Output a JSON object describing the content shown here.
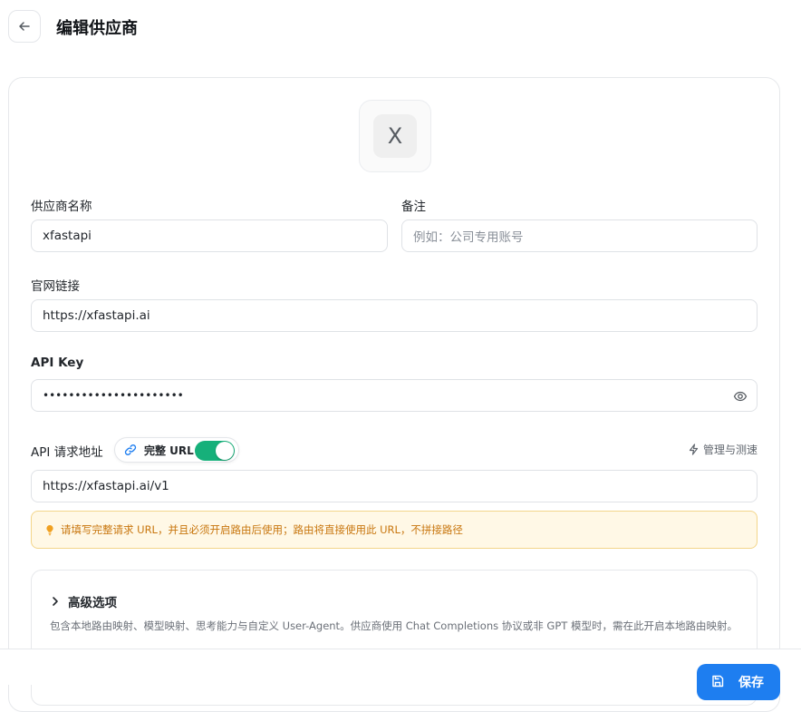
{
  "header": {
    "title": "编辑供应商"
  },
  "logo": {
    "letter": "X"
  },
  "form": {
    "name": {
      "label": "供应商名称",
      "value": "xfastapi"
    },
    "note": {
      "label": "备注",
      "placeholder": "例如：公司专用账号"
    },
    "website": {
      "label": "官网链接",
      "value": "https://xfastapi.ai"
    },
    "api_key": {
      "label": "API Key",
      "masked_value": "••••••••••••••••••••••"
    },
    "api_url": {
      "label": "API 请求地址",
      "full_url_toggle_label": "完整 URL",
      "full_url_enabled": true,
      "manage_label": "管理与测速",
      "value": "https://xfastapi.ai/v1"
    },
    "hint": "请填写完整请求 URL，并且必须开启路由后使用；路由将直接使用此 URL，不拼接路径"
  },
  "advanced": {
    "title": "高级选项",
    "description": "包含本地路由映射、模型映射、思考能力与自定义 User-Agent。供应商使用 Chat Completions 协议或非 GPT 模型时，需在此开启本地路由映射。"
  },
  "footer": {
    "save_label": "保存"
  },
  "colors": {
    "accent": "#1e7ef0",
    "toggle_on": "#16b07a",
    "hint_bg": "#fff8e6",
    "hint_text": "#c8760e"
  }
}
